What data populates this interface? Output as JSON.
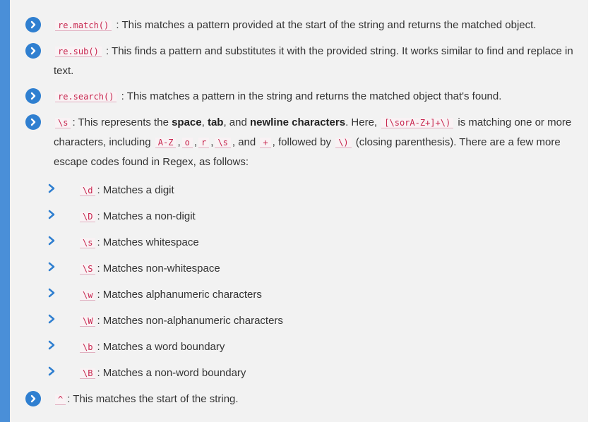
{
  "items": [
    {
      "code": "re.match()",
      "text": ": This matches a pattern provided at the start of the string and returns the matched object."
    },
    {
      "code": "re.sub()",
      "text": ": This finds a pattern and substitutes it with the provided string. It works similar to find and replace in text."
    },
    {
      "code": "re.search()",
      "text": ": This matches a pattern in the string and returns the matched object that's found."
    },
    {
      "code": "\\s",
      "text_a": ": This represents the ",
      "bold_1": "space",
      "text_b": ", ",
      "bold_2": "tab",
      "text_c": ", and ",
      "bold_3": "newline characters",
      "text_d": ". Here, ",
      "code_2": "[\\sorA-Z+]+\\)",
      "text_e": " is matching one or more characters, including ",
      "code_3": "A-Z",
      "sep_1": ",",
      "code_4": "o",
      "sep_2": ",",
      "code_5": "r",
      "sep_3": ",",
      "code_6": "\\s",
      "text_f": ", and ",
      "code_7": "+",
      "text_g": ", followed by ",
      "code_8": "\\)",
      "text_h": " (closing parenthesis). There are a few more escape codes found in Regex, as follows:"
    }
  ],
  "subitems": [
    {
      "code": "\\d",
      "text": ": Matches a digit"
    },
    {
      "code": "\\D",
      "text": ": Matches a non-digit"
    },
    {
      "code": "\\s",
      "text": ": Matches whitespace"
    },
    {
      "code": "\\S",
      "text": ": Matches non-whitespace"
    },
    {
      "code": "\\w",
      "text": ": Matches alphanumeric characters"
    },
    {
      "code": "\\W",
      "text": ": Matches non-alphanumeric characters"
    },
    {
      "code": "\\b",
      "text": ": Matches a word boundary"
    },
    {
      "code": "\\B",
      "text": ": Matches a non-word boundary"
    }
  ],
  "last_item": {
    "code": "^",
    "text": ": This matches the start of the string."
  },
  "colors": {
    "accent_bar": "#4a8fd8",
    "bullet": "#2f7fd0",
    "code_text": "#c7254e"
  },
  "icons": {
    "bullet": "chevron-circle-right-icon",
    "sub_bullet": "chevron-right-icon"
  }
}
